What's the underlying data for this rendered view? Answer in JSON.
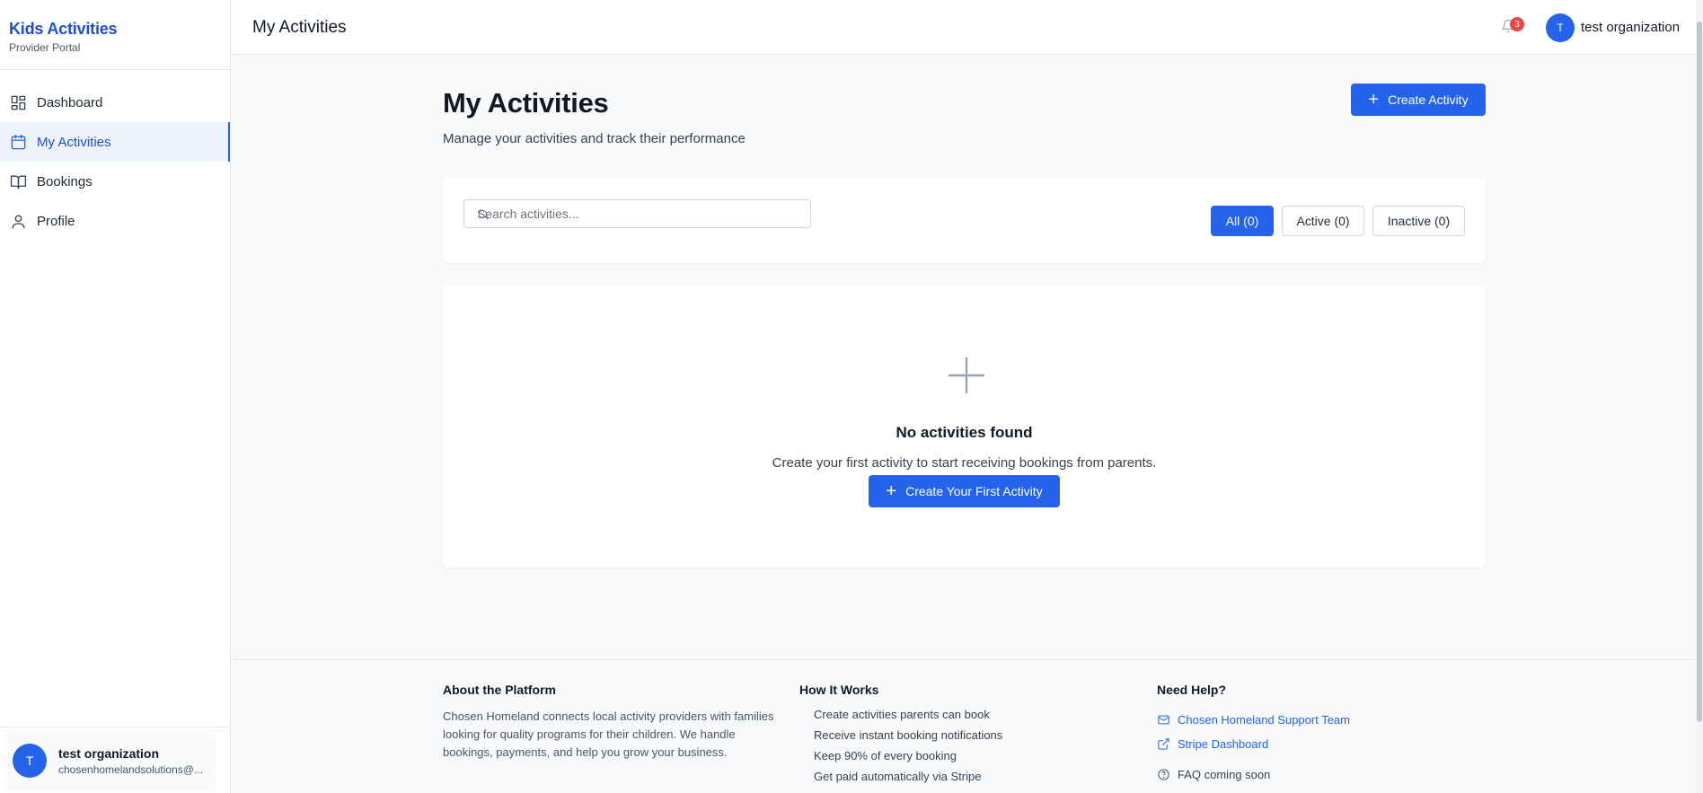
{
  "brand": {
    "title": "Kids Activities",
    "subtitle": "Provider Portal"
  },
  "sidebar": {
    "items": [
      {
        "label": "Dashboard",
        "icon": "grid-icon"
      },
      {
        "label": "My Activities",
        "icon": "calendar-icon",
        "active": true
      },
      {
        "label": "Bookings",
        "icon": "book-icon"
      },
      {
        "label": "Profile",
        "icon": "user-icon"
      }
    ],
    "user": {
      "initial": "T",
      "name": "test organization",
      "email": "chosenhomelandsolutions@..."
    }
  },
  "header": {
    "title": "My Activities",
    "notification_count": "3",
    "user_initial": "T",
    "user_name": "test organization"
  },
  "main": {
    "title": "My Activities",
    "subtitle": "Manage your activities and track their performance",
    "create_label": "Create Activity",
    "search_placeholder": "Search activities...",
    "filters": [
      {
        "label": "All (0)",
        "active": true
      },
      {
        "label": "Active (0)"
      },
      {
        "label": "Inactive (0)"
      }
    ],
    "empty": {
      "title": "No activities found",
      "message": "Create your first activity to start receiving bookings from parents.",
      "button_label": "Create Your First Activity"
    }
  },
  "footer": {
    "about": {
      "heading": "About the Platform",
      "text": "Chosen Homeland connects local activity providers with families looking for quality programs for their children. We handle bookings, payments, and help you grow your business."
    },
    "how": {
      "heading": "How It Works",
      "items": [
        "Create activities parents can book",
        "Receive instant booking notifications",
        "Keep 90% of every booking",
        "Get paid automatically via Stripe"
      ]
    },
    "help": {
      "heading": "Need Help?",
      "support_label": "Chosen Homeland Support Team",
      "stripe_label": "Stripe Dashboard",
      "faq_label": "FAQ coming soon"
    }
  },
  "colors": {
    "accent": "#2563eb",
    "badge": "#ef4444",
    "brand_text": "#1d4ed8"
  }
}
